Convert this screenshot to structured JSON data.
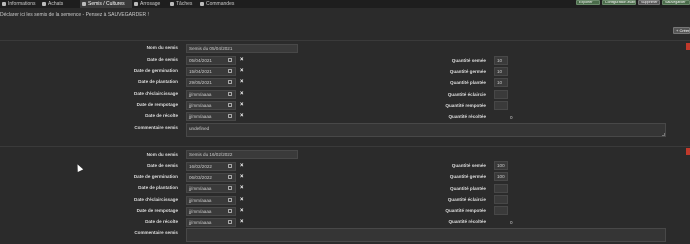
{
  "nav": {
    "tabs": [
      {
        "label": "Informations",
        "icon": "info-icon"
      },
      {
        "label": "Achats",
        "icon": "cart-icon"
      },
      {
        "label": "Semis / Cultures",
        "icon": "seed-icon",
        "active": true
      },
      {
        "label": "Arrosage",
        "icon": "watering-can-icon"
      },
      {
        "label": "Tâches",
        "icon": "tasks-icon"
      },
      {
        "label": "Commandes",
        "icon": "orders-icon"
      }
    ],
    "right_buttons": [
      "Exporter",
      "Configuration avancée",
      "Supprimer",
      "Sauvegarder"
    ]
  },
  "notice": "Déclarer ici les semis de la semence - Pensez à SAUVEGARDER !",
  "create_button": "Créer",
  "semis": [
    {
      "labels": {
        "nom": "Nom du semis",
        "date_semis": "Date de semis",
        "date_germination": "Date de germination",
        "date_plantation": "Date de plantation",
        "date_eclaircissage": "Date d'éclaircissage",
        "date_rempotage": "Date de rempotage",
        "date_recolte": "Date de récolte",
        "commentaire": "Commentaire semis"
      },
      "nom": "Semis du 05/04/2021",
      "dates": [
        "05/04/2021",
        "15/04/2021",
        "29/05/2021",
        "jj/mm/aaaa",
        "jj/mm/aaaa",
        "jj/mm/aaaa"
      ],
      "qty_labels": [
        "Quantité semée",
        "Quantité germée",
        "Quantité plantée",
        "Quantité éclaircie",
        "Quantité rempotée",
        "Quantité récoltée"
      ],
      "qty_values": [
        "10",
        "10",
        "10",
        "",
        "",
        ""
      ],
      "recolte_value": "0",
      "commentaire": "undefined"
    },
    {
      "labels": {
        "nom": "Nom du semis",
        "date_semis": "Date de semis",
        "date_germination": "Date de germination",
        "date_plantation": "Date de plantation",
        "date_eclaircissage": "Date d'éclaircissage",
        "date_rempotage": "Date de rempotage",
        "date_recolte": "Date de récolte",
        "commentaire": "Commentaire semis"
      },
      "nom": "Semis du 16/02/2022",
      "dates": [
        "16/02/2022",
        "06/03/2022",
        "jj/mm/aaaa",
        "jj/mm/aaaa",
        "jj/mm/aaaa",
        "jj/mm/aaaa"
      ],
      "qty_labels": [
        "Quantité semée",
        "Quantité germée",
        "Quantité plantée",
        "Quantité éclaircie",
        "Quantité rempotée",
        "Quantité récoltée"
      ],
      "qty_values": [
        "100",
        "100",
        "",
        "",
        "",
        ""
      ],
      "recolte_value": "0",
      "commentaire": ""
    }
  ],
  "colors": {
    "background": "#2b2b2b",
    "nav_active": "#3a3a3a",
    "accent_red": "#c0392b",
    "save_green": "#4a6b4a"
  }
}
